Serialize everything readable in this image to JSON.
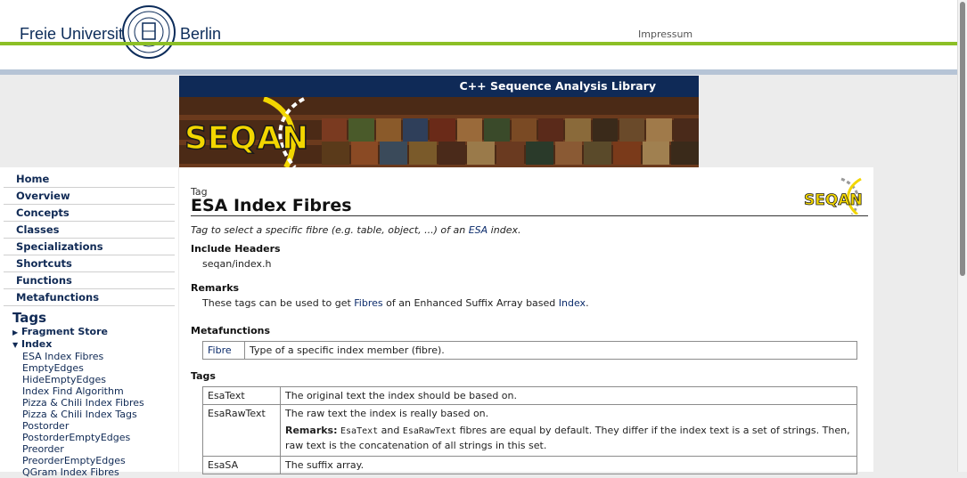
{
  "header": {
    "university_name": "Freie Universität",
    "university_city": "Berlin",
    "impressum": "Impressum"
  },
  "banner": {
    "subtitle": "C++ Sequence Analysis Library",
    "logo_text": "SEQAN"
  },
  "sidebar": {
    "nav": [
      "Home",
      "Overview",
      "Concepts",
      "Classes",
      "Specializations",
      "Shortcuts",
      "Functions",
      "Metafunctions"
    ],
    "tags_heading": "Tags",
    "tree": {
      "fragment_store": "Fragment Store",
      "index": "Index",
      "index_items": [
        "ESA Index Fibres",
        "EmptyEdges",
        "HideEmptyEdges",
        "Index Find Algorithm",
        "Pizza & Chili Index Fibres",
        "Pizza & Chili Index Tags",
        "Postorder",
        "PostorderEmptyEdges",
        "Preorder",
        "PreorderEmptyEdges",
        "QGram Index Fibres"
      ]
    }
  },
  "main": {
    "kind": "Tag",
    "title": "ESA Index Fibres",
    "description_prefix": "Tag to select a specific fibre (e.g. table, object, ...) of an ",
    "description_link": "ESA",
    "description_suffix": " index.",
    "include_headers_label": "Include Headers",
    "include_header_value": "seqan/index.h",
    "remarks_label": "Remarks",
    "remarks_prefix": "These tags can be used to get ",
    "remarks_link1": "Fibres",
    "remarks_middle": " of an Enhanced Suffix Array based ",
    "remarks_link2": "Index",
    "remarks_suffix": ".",
    "metafunctions_label": "Metafunctions",
    "metafunctions": [
      {
        "name": "Fibre",
        "desc": "Type of a specific index member (fibre)."
      }
    ],
    "tags_label": "Tags",
    "tags": [
      {
        "name": "EsaText",
        "desc": "The original text the index should be based on."
      },
      {
        "name": "EsaRawText",
        "desc": "The raw text the index is really based on.",
        "remark_label": "Remarks:",
        "remark_code1": "EsaText",
        "remark_and": " and ",
        "remark_code2": "EsaRawText",
        "remark_rest": " fibres are equal by default. They differ if the index text is a set of strings. Then, raw text is the concatenation of all strings in this set."
      },
      {
        "name": "EsaSA",
        "desc": "The suffix array."
      }
    ]
  },
  "colors": {
    "fu_green": "#8cbf26",
    "navy": "#0f2a57",
    "seqan_yellow": "#f2d600"
  }
}
